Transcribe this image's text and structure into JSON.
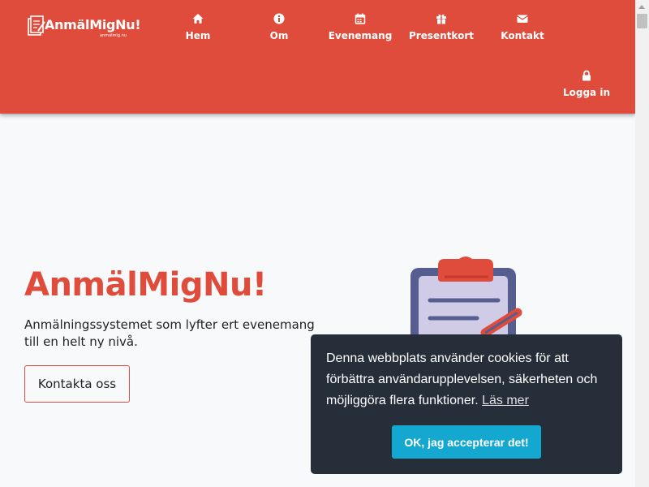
{
  "brand": {
    "name": "AnmälMigNu!",
    "domain": "anmalmig.nu",
    "color": "#df4c3b"
  },
  "nav": {
    "items": [
      {
        "label": "Hem",
        "icon": "home-icon"
      },
      {
        "label": "Om",
        "icon": "info-icon"
      },
      {
        "label": "Evenemang",
        "icon": "calendar-icon"
      },
      {
        "label": "Presentkort",
        "icon": "gift-icon"
      },
      {
        "label": "Kontakt",
        "icon": "envelope-icon"
      }
    ],
    "login": {
      "label": "Logga in",
      "icon": "lock-icon"
    }
  },
  "hero": {
    "title": "AnmälMigNu!",
    "tagline": "Anmälningssystemet som lyfter ert evenemang till en helt ny nivå.",
    "cta_label": "Kontakta oss",
    "illustration": "clipboard-pencil-icon"
  },
  "cookie": {
    "message": "Denna webbplats använder cookies för att förbättra användarupplevelsen, säkerheten och möjliggöra flera funktioner.",
    "link_label": "Läs mer",
    "accept_label": "OK, jag accepterar det!",
    "background": "#252e39",
    "button_color": "#14a7d0"
  }
}
